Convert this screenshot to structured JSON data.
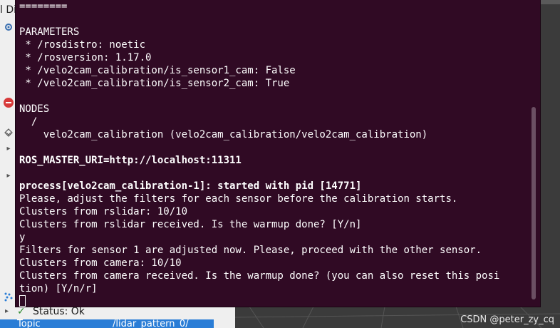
{
  "background": {
    "left_panel_title": "l Dis",
    "status_label": "Status: Ok",
    "topic_label": "Topic",
    "topic_value": "/lidar_pattern_0/",
    "watermark": "CSDN @peter_zy_cq",
    "icons": [
      "gear-icon",
      "error-icon",
      "layers-icon",
      "expand-arrow-icon",
      "points-icon",
      "check-icon"
    ],
    "colors": {
      "topic_highlight": "#2a7dd6",
      "status_check": "#2e8b2e"
    }
  },
  "terminal": {
    "background": "#300a24",
    "lines": [
      {
        "text": "========",
        "bold": false
      },
      {
        "text": "",
        "bold": false
      },
      {
        "text": "PARAMETERS",
        "bold": false
      },
      {
        "text": " * /rosdistro: noetic",
        "bold": false
      },
      {
        "text": " * /rosversion: 1.17.0",
        "bold": false
      },
      {
        "text": " * /velo2cam_calibration/is_sensor1_cam: False",
        "bold": false
      },
      {
        "text": " * /velo2cam_calibration/is_sensor2_cam: True",
        "bold": false
      },
      {
        "text": "",
        "bold": false
      },
      {
        "text": "NODES",
        "bold": false
      },
      {
        "text": "  /",
        "bold": false
      },
      {
        "text": "    velo2cam_calibration (velo2cam_calibration/velo2cam_calibration)",
        "bold": false
      },
      {
        "text": "",
        "bold": false
      },
      {
        "text": "ROS_MASTER_URI=http://localhost:11311",
        "bold": true
      },
      {
        "text": "",
        "bold": false
      },
      {
        "text": "process[velo2cam_calibration-1]: started with pid [14771]",
        "bold": true
      },
      {
        "text": "Please, adjust the filters for each sensor before the calibration starts.",
        "bold": false
      },
      {
        "text": "Clusters from rslidar: 10/10",
        "bold": false
      },
      {
        "text": "Clusters from rslidar received. Is the warmup done? [Y/n]",
        "bold": false
      },
      {
        "text": "y",
        "bold": false
      },
      {
        "text": "Filters for sensor 1 are adjusted now. Please, proceed with the other sensor.",
        "bold": false
      },
      {
        "text": "Clusters from camera: 10/10",
        "bold": false
      },
      {
        "text": "Clusters from camera received. Is the warmup done? (you can also reset this posi",
        "bold": false
      },
      {
        "text": "tion) [Y/n/r]",
        "bold": false
      }
    ]
  }
}
